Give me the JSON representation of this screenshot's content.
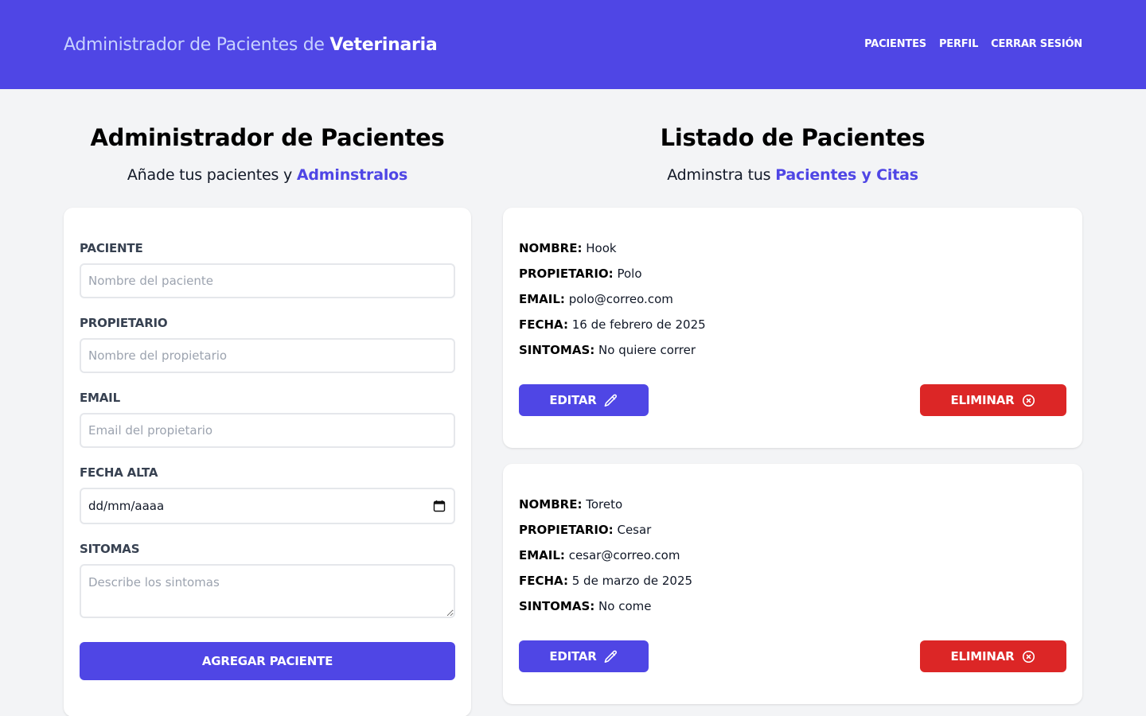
{
  "header": {
    "brand_prefix": "Administrador de Pacientes de ",
    "brand_highlight": "Veterinaria",
    "nav": [
      "PACIENTES",
      "PERFIL",
      "CERRAR SESIÓN"
    ]
  },
  "form_section": {
    "title": "Administrador de Pacientes",
    "subtitle_prefix": "Añade tus pacientes y ",
    "subtitle_highlight": "Adminstralos",
    "fields": {
      "paciente": {
        "label": "PACIENTE",
        "placeholder": "Nombre del paciente",
        "value": ""
      },
      "propietario": {
        "label": "PROPIETARIO",
        "placeholder": "Nombre del propietario",
        "value": ""
      },
      "email": {
        "label": "EMAIL",
        "placeholder": "Email del propietario",
        "value": ""
      },
      "fecha": {
        "label": "FECHA ALTA",
        "value": "dd/mm/aaaa"
      },
      "sintomas": {
        "label": "SITOMAS",
        "placeholder": "Describe los sintomas",
        "value": ""
      }
    },
    "submit_label": "AGREGAR PACIENTE"
  },
  "list_section": {
    "title": "Listado de Pacientes",
    "subtitle_prefix": "Adminstra tus ",
    "subtitle_highlight": "Pacientes y Citas",
    "keys": {
      "nombre": "NOMBRE:",
      "propietario": "PROPIETARIO:",
      "email": "EMAIL:",
      "fecha": "FECHA:",
      "sintomas": "SINTOMAS:"
    },
    "edit_label": "EDITAR",
    "delete_label": "ELIMINAR",
    "patients": [
      {
        "nombre": "Hook",
        "propietario": "Polo",
        "email": "polo@correo.com",
        "fecha": "16 de febrero de 2025",
        "sintomas": "No quiere correr"
      },
      {
        "nombre": "Toreto",
        "propietario": "Cesar",
        "email": "cesar@correo.com",
        "fecha": "5 de marzo de 2025",
        "sintomas": "No come"
      }
    ]
  },
  "colors": {
    "primary": "#4f46e5",
    "danger": "#dc2626",
    "background": "#f3f4f6"
  },
  "icons": {
    "edit": "pencil-icon",
    "delete": "x-circle-icon",
    "date": "calendar-icon"
  }
}
